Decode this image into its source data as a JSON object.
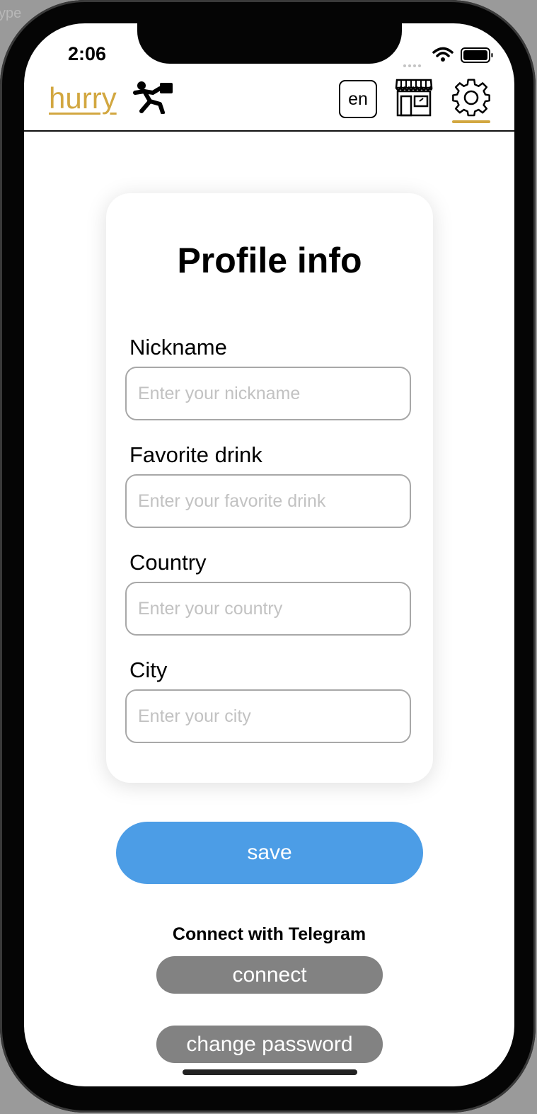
{
  "background_fragment": "ype",
  "status_bar": {
    "time": "2:06"
  },
  "header": {
    "logo_text": "hurry",
    "language_button": "en",
    "accent_color": "#d2a740"
  },
  "icons": [
    "runner-icon",
    "shop-icon",
    "gear-icon",
    "wifi-icon",
    "battery-icon"
  ],
  "card": {
    "title": "Profile info",
    "fields": [
      {
        "label": "Nickname",
        "value": "",
        "placeholder": "Enter your nickname"
      },
      {
        "label": "Favorite drink",
        "value": "",
        "placeholder": "Enter your favorite drink"
      },
      {
        "label": "Country",
        "value": "",
        "placeholder": "Enter your country"
      },
      {
        "label": "City",
        "value": "",
        "placeholder": "Enter your city"
      }
    ]
  },
  "buttons": {
    "save": "save",
    "telegram_label": "Connect with Telegram",
    "connect": "connect",
    "change_password": "change password"
  },
  "colors": {
    "save_button": "#4c9de6",
    "grey_button": "#828282"
  }
}
